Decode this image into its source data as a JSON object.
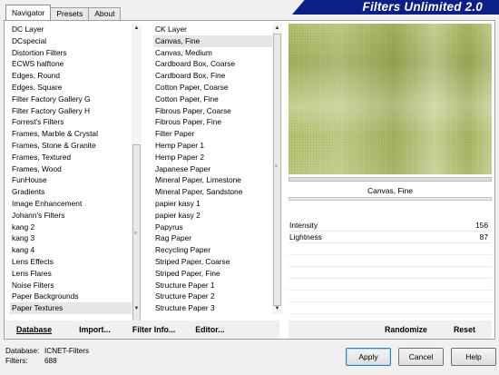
{
  "banner": {
    "title": "Filters Unlimited 2.0"
  },
  "tabs": [
    {
      "label": "Navigator",
      "active": true
    },
    {
      "label": "Presets",
      "active": false
    },
    {
      "label": "About",
      "active": false
    }
  ],
  "categories": {
    "items": [
      "DC Layer",
      "DCspecial",
      "Distortion Filters",
      "ECWS halftone",
      "Edges, Round",
      "Edges, Square",
      "Filter Factory Gallery G",
      "Filter Factory Gallery H",
      "Forrest's Filters",
      "Frames, Marble & Crystal",
      "Frames, Stone & Granite",
      "Frames, Textured",
      "Frames, Wood",
      "FunHouse",
      "Gradients",
      "Image Enhancement",
      "Johann's Filters",
      "kang 2",
      "kang 3",
      "kang 4",
      "Lens Effects",
      "Lens Flares",
      "Noise Filters",
      "Paper Backgrounds",
      "Paper Textures"
    ],
    "selected_index": 24
  },
  "filters": {
    "items": [
      "CK Layer",
      "Canvas, Fine",
      "Canvas, Medium",
      "Cardboard Box, Coarse",
      "Cardboard Box, Fine",
      "Cotton Paper, Coarse",
      "Cotton Paper, Fine",
      "Fibrous Paper, Coarse",
      "Fibrous Paper, Fine",
      "Filter Paper",
      "Hemp Paper 1",
      "Hemp Paper 2",
      "Japanese Paper",
      "Mineral Paper, Limestone",
      "Mineral Paper, Sandstone",
      "papier kasy 1",
      "papier kasy 2",
      "Papyrus",
      "Rag Paper",
      "Recycling Paper",
      "Striped Paper, Coarse",
      "Striped Paper, Fine",
      "Structure Paper 1",
      "Structure Paper 2",
      "Structure Paper 3"
    ],
    "selected_index": 1
  },
  "preview": {
    "filter_name": "Canvas, Fine",
    "texture_color": "#b2c06b"
  },
  "parameters": [
    {
      "name": "Intensity",
      "value": "156"
    },
    {
      "name": "Lightness",
      "value": "87"
    }
  ],
  "bottom_left": {
    "database": "Database",
    "import": "Import...",
    "filter_info": "Filter Info...",
    "editor": "Editor..."
  },
  "bottom_right": {
    "randomize": "Randomize",
    "reset": "Reset"
  },
  "footer": {
    "database_label": "Database:",
    "database_value": "ICNET-Filters",
    "filters_label": "Filters:",
    "filters_value": "688"
  },
  "dialog_buttons": {
    "apply": "Apply",
    "cancel": "Cancel",
    "help": "Help"
  },
  "colors": {
    "banner": "#0b1f86",
    "preview": "#b2c06b"
  }
}
